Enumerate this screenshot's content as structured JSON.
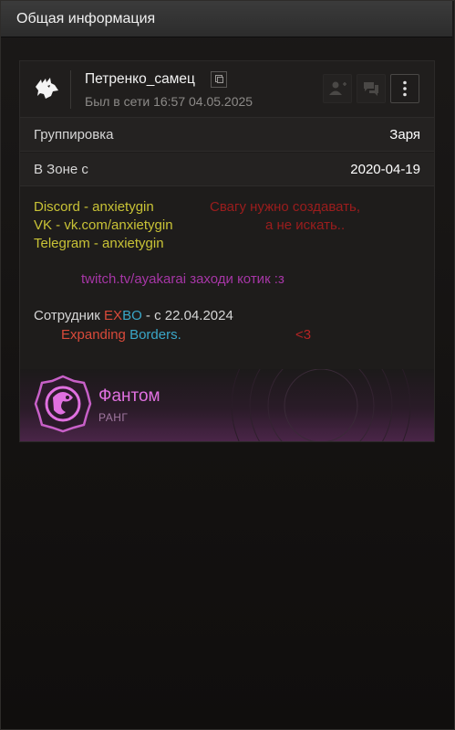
{
  "window": {
    "title": "Общая информация"
  },
  "profile": {
    "nickname": "Петренко_самец",
    "status": "Был в сети 16:57 04.05.2025"
  },
  "fields": [
    {
      "label": "Группировка",
      "value": "Заря"
    },
    {
      "label": "В Зоне с",
      "value": "2020-04-19"
    }
  ],
  "bio": {
    "discord": "Discord - anxietygin",
    "vk": "VK - vk.com/anxietygin",
    "telegram": "Telegram - anxietygin",
    "quote_line1": "Свагу нужно создавать,",
    "quote_line2": "а не искать..",
    "twitch": "twitch.tv/ayakarai заходи котик :з",
    "employee_prefix": "Сотрудник ",
    "ex": "EX",
    "bo": "BO",
    "employee_suffix": " - с 22.04.2024",
    "expanding": "Expanding ",
    "borders": "Borders",
    "dot": ".",
    "heart": "<3"
  },
  "rank": {
    "title": "Фантом",
    "subtitle": "РАНГ"
  },
  "colors": {
    "accent_yellow": "#c9c336",
    "accent_red": "#9c1d1d",
    "accent_purple": "#a636a6",
    "exbo_red": "#d94a3a",
    "exbo_blue": "#3aa7c8",
    "rank_pink": "#e070e0"
  },
  "icons": {
    "avatar": "wolf-emblem-icon",
    "copy": "copy-icon",
    "add_friend": "add-friend-icon",
    "chat": "chat-icon",
    "more": "more-vertical-icon",
    "rank": "phantom-rank-emblem-icon"
  }
}
